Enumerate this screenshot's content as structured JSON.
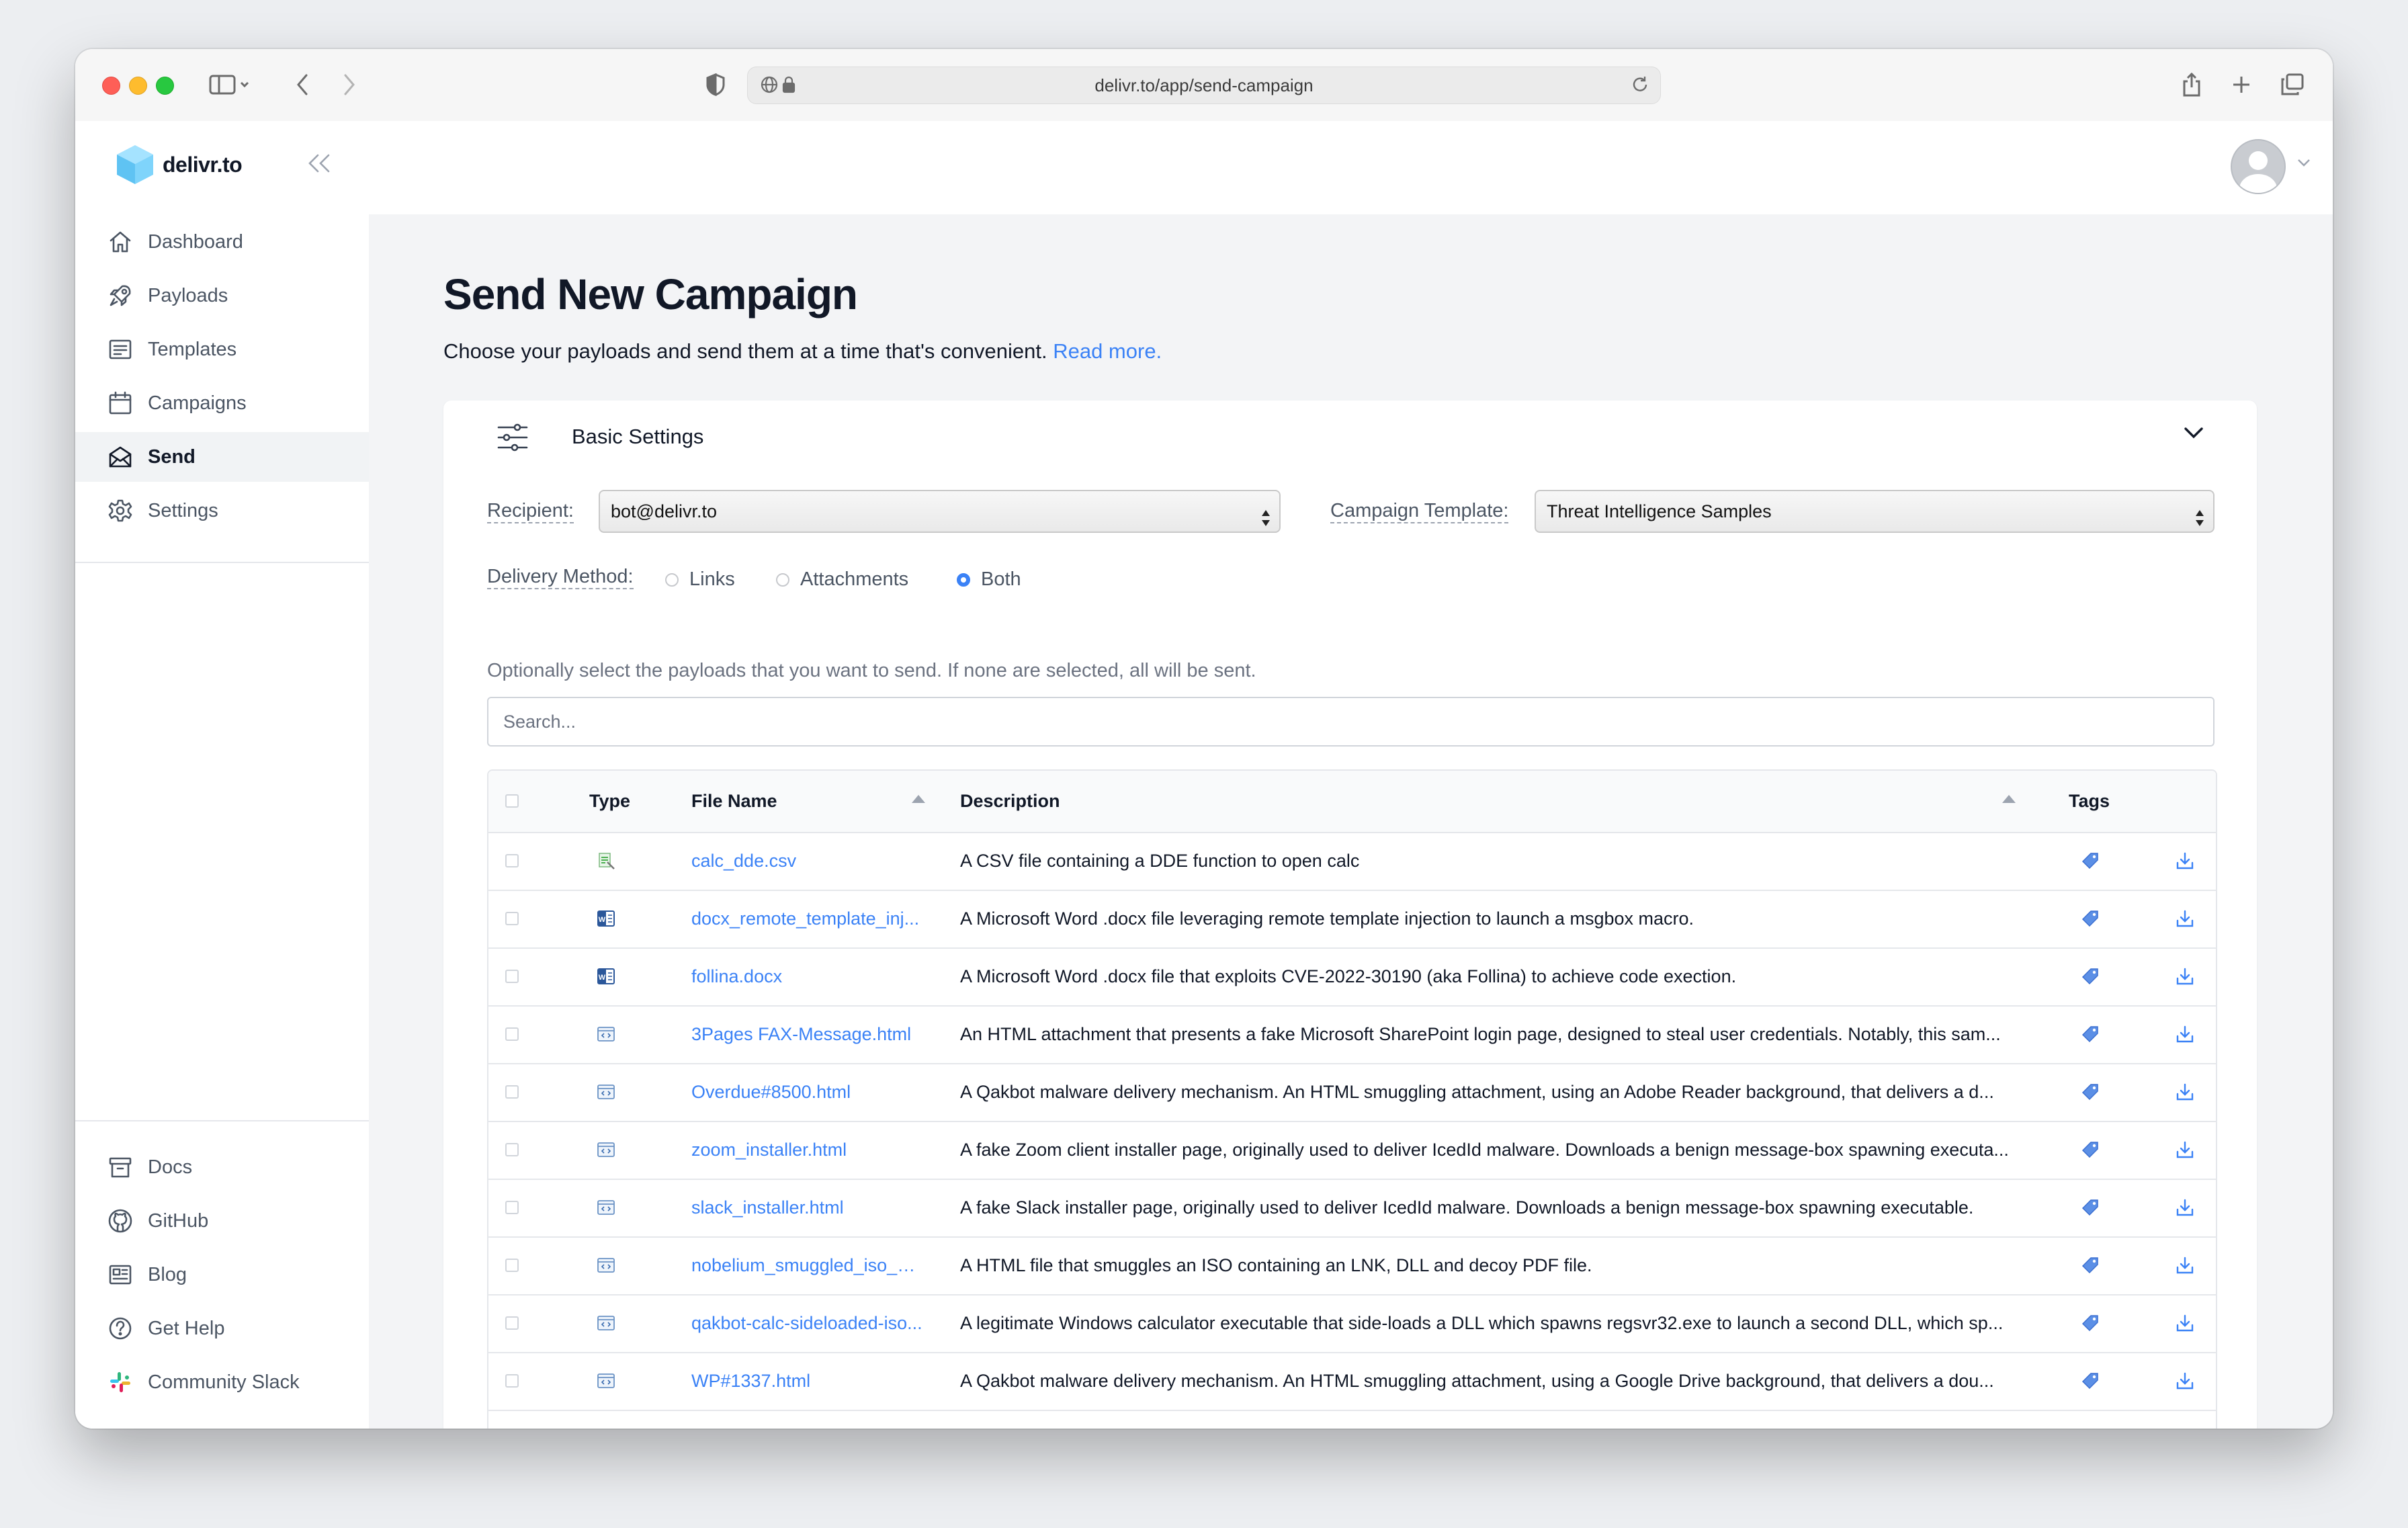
{
  "browser": {
    "url": "delivr.to/app/send-campaign"
  },
  "sidebar": {
    "brand": "delivr.to",
    "items": [
      {
        "label": "Dashboard",
        "icon": "home-icon"
      },
      {
        "label": "Payloads",
        "icon": "rocket-icon"
      },
      {
        "label": "Templates",
        "icon": "template-icon"
      },
      {
        "label": "Campaigns",
        "icon": "calendar-icon"
      },
      {
        "label": "Send",
        "icon": "envelope-open-icon",
        "active": true
      },
      {
        "label": "Settings",
        "icon": "gear-icon"
      }
    ],
    "footer_items": [
      {
        "label": "Docs",
        "icon": "archive-icon"
      },
      {
        "label": "GitHub",
        "icon": "github-icon"
      },
      {
        "label": "Blog",
        "icon": "newspaper-icon"
      },
      {
        "label": "Get Help",
        "icon": "question-icon"
      },
      {
        "label": "Community Slack",
        "icon": "slack-icon"
      }
    ]
  },
  "page": {
    "title": "Send New Campaign",
    "subtitle": "Choose your payloads and send them at a time that's convenient.",
    "read_more": "Read more."
  },
  "settings": {
    "title": "Basic Settings",
    "recipient_label": "Recipient:",
    "recipient_value": "bot@delivr.to",
    "template_label": "Campaign Template:",
    "template_value": "Threat Intelligence Samples",
    "delivery_label": "Delivery Method:",
    "delivery_options": [
      {
        "label": "Links",
        "selected": false
      },
      {
        "label": "Attachments",
        "selected": false
      },
      {
        "label": "Both",
        "selected": true
      }
    ],
    "hint": "Optionally select the payloads that you want to send. If none are selected, all will be sent.",
    "search_placeholder": "Search..."
  },
  "table": {
    "headers": {
      "type": "Type",
      "file_name": "File Name",
      "description": "Description",
      "tags": "Tags"
    },
    "rows": [
      {
        "type": "csv",
        "file": "calc_dde.csv",
        "description": "A CSV file containing a DDE function to open calc"
      },
      {
        "type": "docx",
        "file": "docx_remote_template_inj...",
        "description": "A Microsoft Word .docx file leveraging remote template injection to launch a msgbox macro."
      },
      {
        "type": "docx",
        "file": "follina.docx",
        "description": "A Microsoft Word .docx file that exploits CVE-2022-30190 (aka Follina) to achieve code exection."
      },
      {
        "type": "html",
        "file": "3Pages FAX-Message.html",
        "description": "An HTML attachment that presents a fake Microsoft SharePoint login page, designed to steal user credentials. Notably, this sam..."
      },
      {
        "type": "html",
        "file": "Overdue#8500.html",
        "description": "A Qakbot malware delivery mechanism. An HTML smuggling attachment, using an Adobe Reader background, that delivers a d..."
      },
      {
        "type": "html",
        "file": "zoom_installer.html",
        "description": "A fake Zoom client installer page, originally used to deliver IcedId malware. Downloads a benign message-box spawning executa..."
      },
      {
        "type": "html",
        "file": "slack_installer.html",
        "description": "A fake Slack installer page, originally used to deliver IcedId malware. Downloads a benign message-box spawning executable."
      },
      {
        "type": "html",
        "file": "nobelium_smuggled_iso_wi...",
        "description": "A HTML file that smuggles an ISO containing an LNK, DLL and decoy PDF file."
      },
      {
        "type": "html",
        "file": "qakbot-calc-sideloaded-iso...",
        "description": "A legitimate Windows calculator executable that side-loads a DLL which spawns regsvr32.exe to launch a second DLL, which sp..."
      },
      {
        "type": "html",
        "file": "WP#1337.html",
        "description": "A Qakbot malware delivery mechanism. An HTML smuggling attachment, using a Google Drive background, that delivers a dou..."
      }
    ]
  },
  "colors": {
    "accent": "#3b82f6",
    "background": "#f3f4f6"
  }
}
